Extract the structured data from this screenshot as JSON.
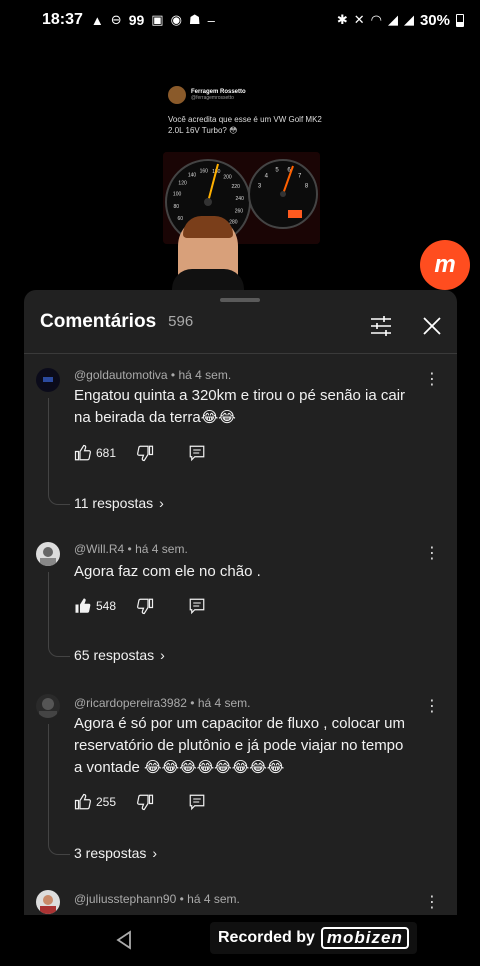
{
  "status_bar": {
    "time": "18:37",
    "left_icons": [
      "warning-icon",
      "sync-icon",
      "99",
      "gallery-icon",
      "chrome-icon",
      "robot-icon",
      "–"
    ],
    "notification_count": "99",
    "dash": "–",
    "battery": "30%"
  },
  "video": {
    "tweet_author": "Ferragem Rossetto",
    "tweet_handle": "@ferragemrossetto",
    "tweet_text": "Você acredita que esse é um VW Golf MK2 2.0L 16V Turbo? 😳",
    "speedo_ticks": [
      "60",
      "80",
      "100",
      "120",
      "140",
      "160",
      "180",
      "200",
      "220",
      "240",
      "260",
      "280",
      "300"
    ],
    "tach_ticks": [
      "3",
      "4",
      "5",
      "6",
      "7",
      "8"
    ]
  },
  "badge": {
    "letter": "m"
  },
  "comments_panel": {
    "title": "Comentários",
    "count": "596",
    "comments": [
      {
        "author": "@goldautomotiva",
        "time": "há 4 sem.",
        "text": "Engatou quinta a 320km e tirou o pé senão ia cair na beirada da terra😂😂",
        "likes": "681",
        "liked": false,
        "replies": "11 respostas"
      },
      {
        "author": "@Will.R4",
        "time": "há 4 sem.",
        "text": "Agora faz com ele no chão .",
        "likes": "548",
        "liked": true,
        "replies": "65 respostas"
      },
      {
        "author": "@ricardopereira3982",
        "time": "há 4 sem.",
        "text": "Agora é só por um capacitor de fluxo , colocar um reservatório de plutônio e já pode viajar no tempo a vontade 😂😂😂😂😂😂😂😂",
        "likes": "255",
        "liked": false,
        "replies": "3 respostas"
      },
      {
        "author": "@juliusstephann90",
        "time": "há 4 sem.",
        "text": ""
      }
    ]
  },
  "watermark": {
    "label": "Recorded by",
    "brand": "mobizen"
  },
  "colors": {
    "sheet_bg": "#212121",
    "badge": "#ff4d1f",
    "meta_text": "#aaaaaa"
  }
}
